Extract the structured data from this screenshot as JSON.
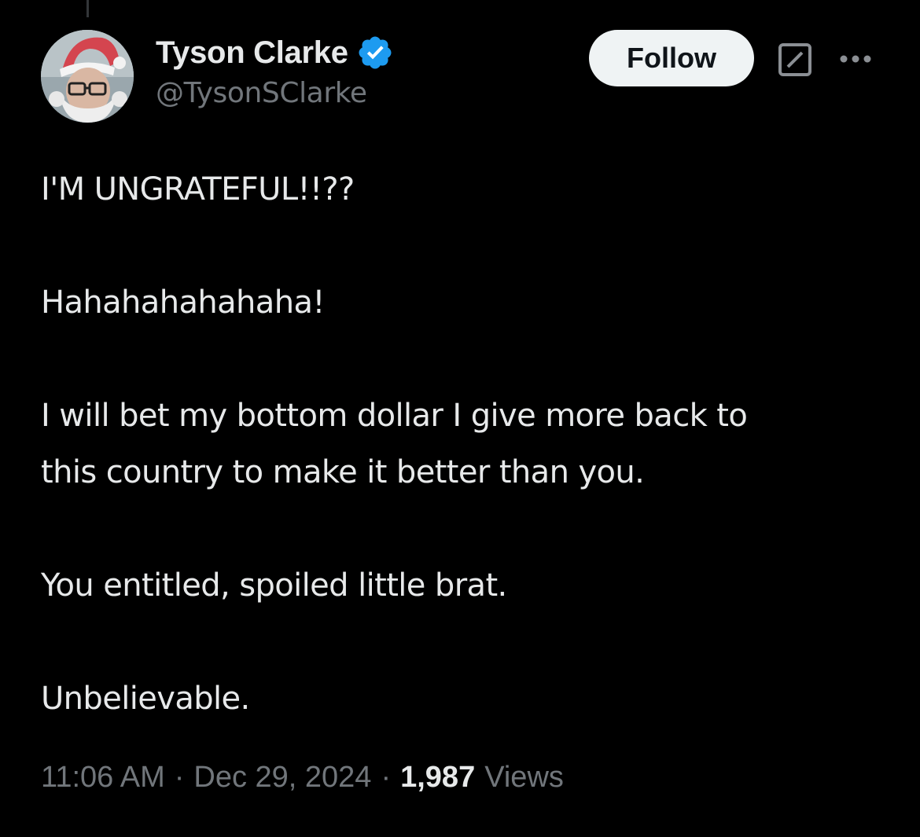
{
  "author": {
    "display_name": "Tyson Clarke",
    "handle": "@TysonSClarke",
    "verified": true,
    "verified_color": "#1d9bf0"
  },
  "actions": {
    "follow_label": "Follow",
    "grok_icon": "grok-icon",
    "more_icon": "more-icon"
  },
  "tweet": {
    "paragraphs": [
      "I'M UNGRATEFUL!!??",
      "Hahahahahahaha!",
      "I will bet my bottom dollar I give more back to\nthis country to make it better than you.",
      "You entitled, spoiled little brat.",
      "Unbelievable."
    ]
  },
  "meta": {
    "time": "11:06 AM",
    "date": "Dec 29, 2024",
    "separator": "·",
    "views_count": "1,987",
    "views_label": "Views"
  },
  "colors": {
    "background": "#000000",
    "text_primary": "#e7e9ea",
    "text_secondary": "#71767b",
    "follow_bg": "#eff3f4"
  }
}
